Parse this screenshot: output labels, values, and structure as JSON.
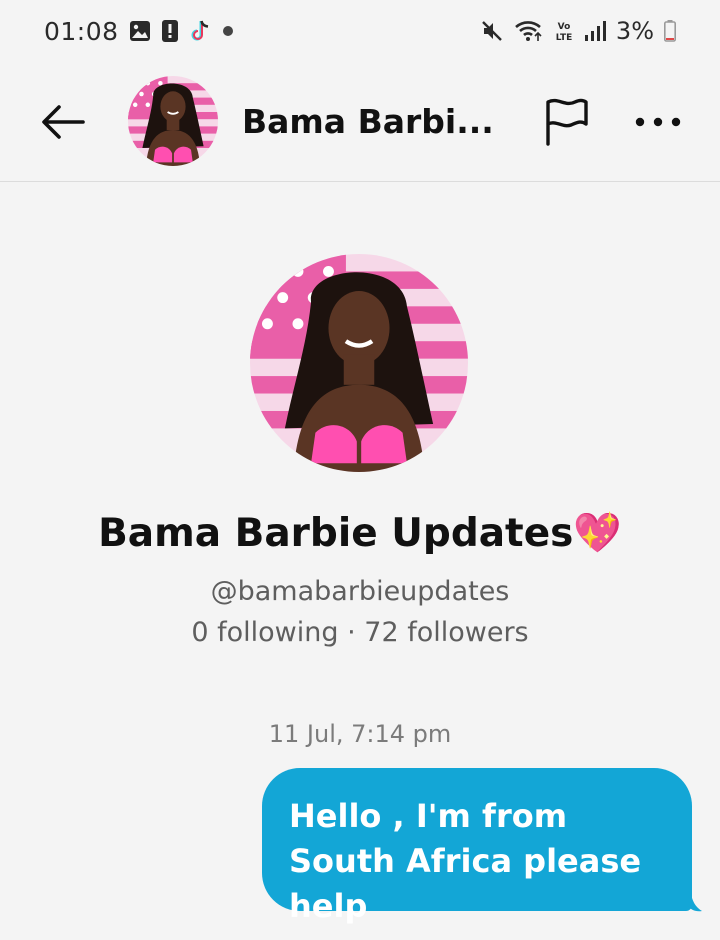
{
  "status_bar": {
    "time": "01:08",
    "left_icons": [
      "gallery-icon",
      "alert-icon",
      "tiktok-icon",
      "dot-icon"
    ],
    "right_icons": [
      "mute-icon",
      "wifi-icon",
      "volte-icon",
      "signal-icon"
    ],
    "battery_percent": "3%"
  },
  "header": {
    "title": "Bama Barbi..."
  },
  "profile": {
    "name": "Bama Barbie Updates",
    "name_emoji": "💖",
    "handle": "@bamabarbieupdates",
    "stats": "0 following · 72 followers"
  },
  "conversation": {
    "timestamp": "11 Jul, 7:14 pm",
    "messages": [
      {
        "text": "Hello , I'm from South Africa please help",
        "sender": "me"
      }
    ]
  },
  "colors": {
    "background": "#f4f4f4",
    "bubble": "#13a6d6",
    "avatar_flag_pink": "#e95fa8",
    "avatar_flag_light": "#f6d8e8"
  }
}
